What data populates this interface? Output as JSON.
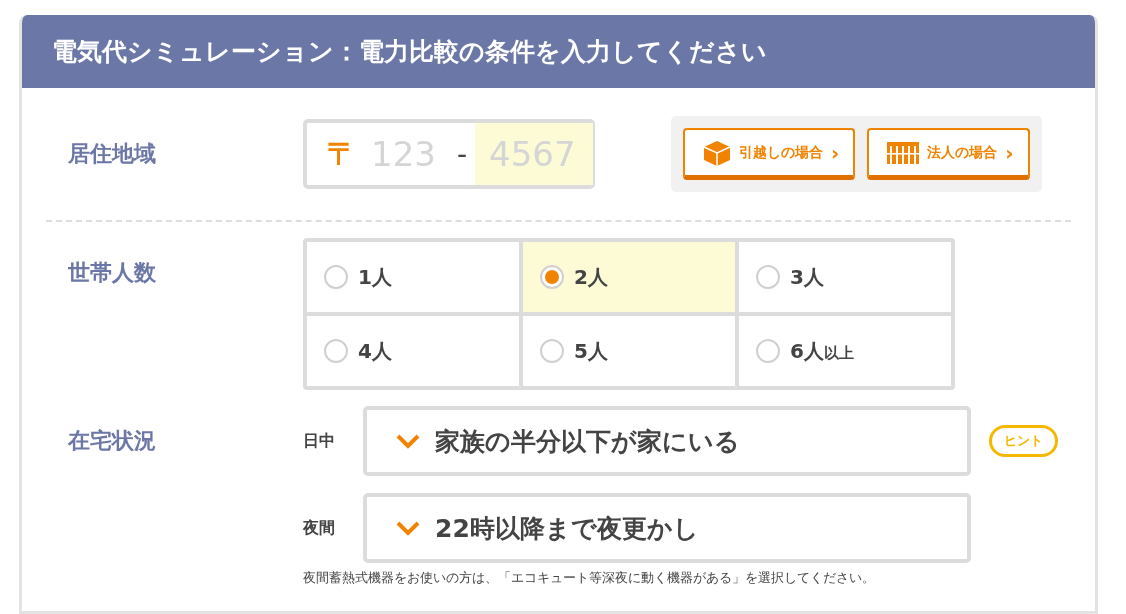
{
  "header": {
    "title": "電気代シミュレーション：電力比較の条件を入力してください"
  },
  "region": {
    "label": "居住地域",
    "postal_mark": "〒",
    "part1": {
      "placeholder": "123",
      "focused": false
    },
    "separator": "-",
    "part2": {
      "placeholder": "4567",
      "focused": true
    },
    "buttons": [
      {
        "kind": "moving",
        "label": "引越しの場合",
        "arrow": "›"
      },
      {
        "kind": "business",
        "label": "法人の場合",
        "arrow": "›"
      }
    ]
  },
  "household": {
    "label": "世帯人数",
    "options": [
      {
        "label": "1人",
        "selected": false
      },
      {
        "label": "2人",
        "selected": true
      },
      {
        "label": "3人",
        "selected": false
      },
      {
        "label": "4人",
        "selected": false
      },
      {
        "label": "5人",
        "selected": false
      },
      {
        "label": "6人",
        "suffix": "以上",
        "selected": false
      }
    ]
  },
  "presence": {
    "label": "在宅状況",
    "selects": [
      {
        "label": "日中",
        "value": "家族の半分以下が家にいる",
        "hint": "ヒント"
      },
      {
        "label": "夜間",
        "value": "22時以降まで夜更かし"
      }
    ],
    "note": "夜間蓄熱式機器をお使いの方は、「エコキュート等深夜に動く機器がある」を選択してください。"
  }
}
